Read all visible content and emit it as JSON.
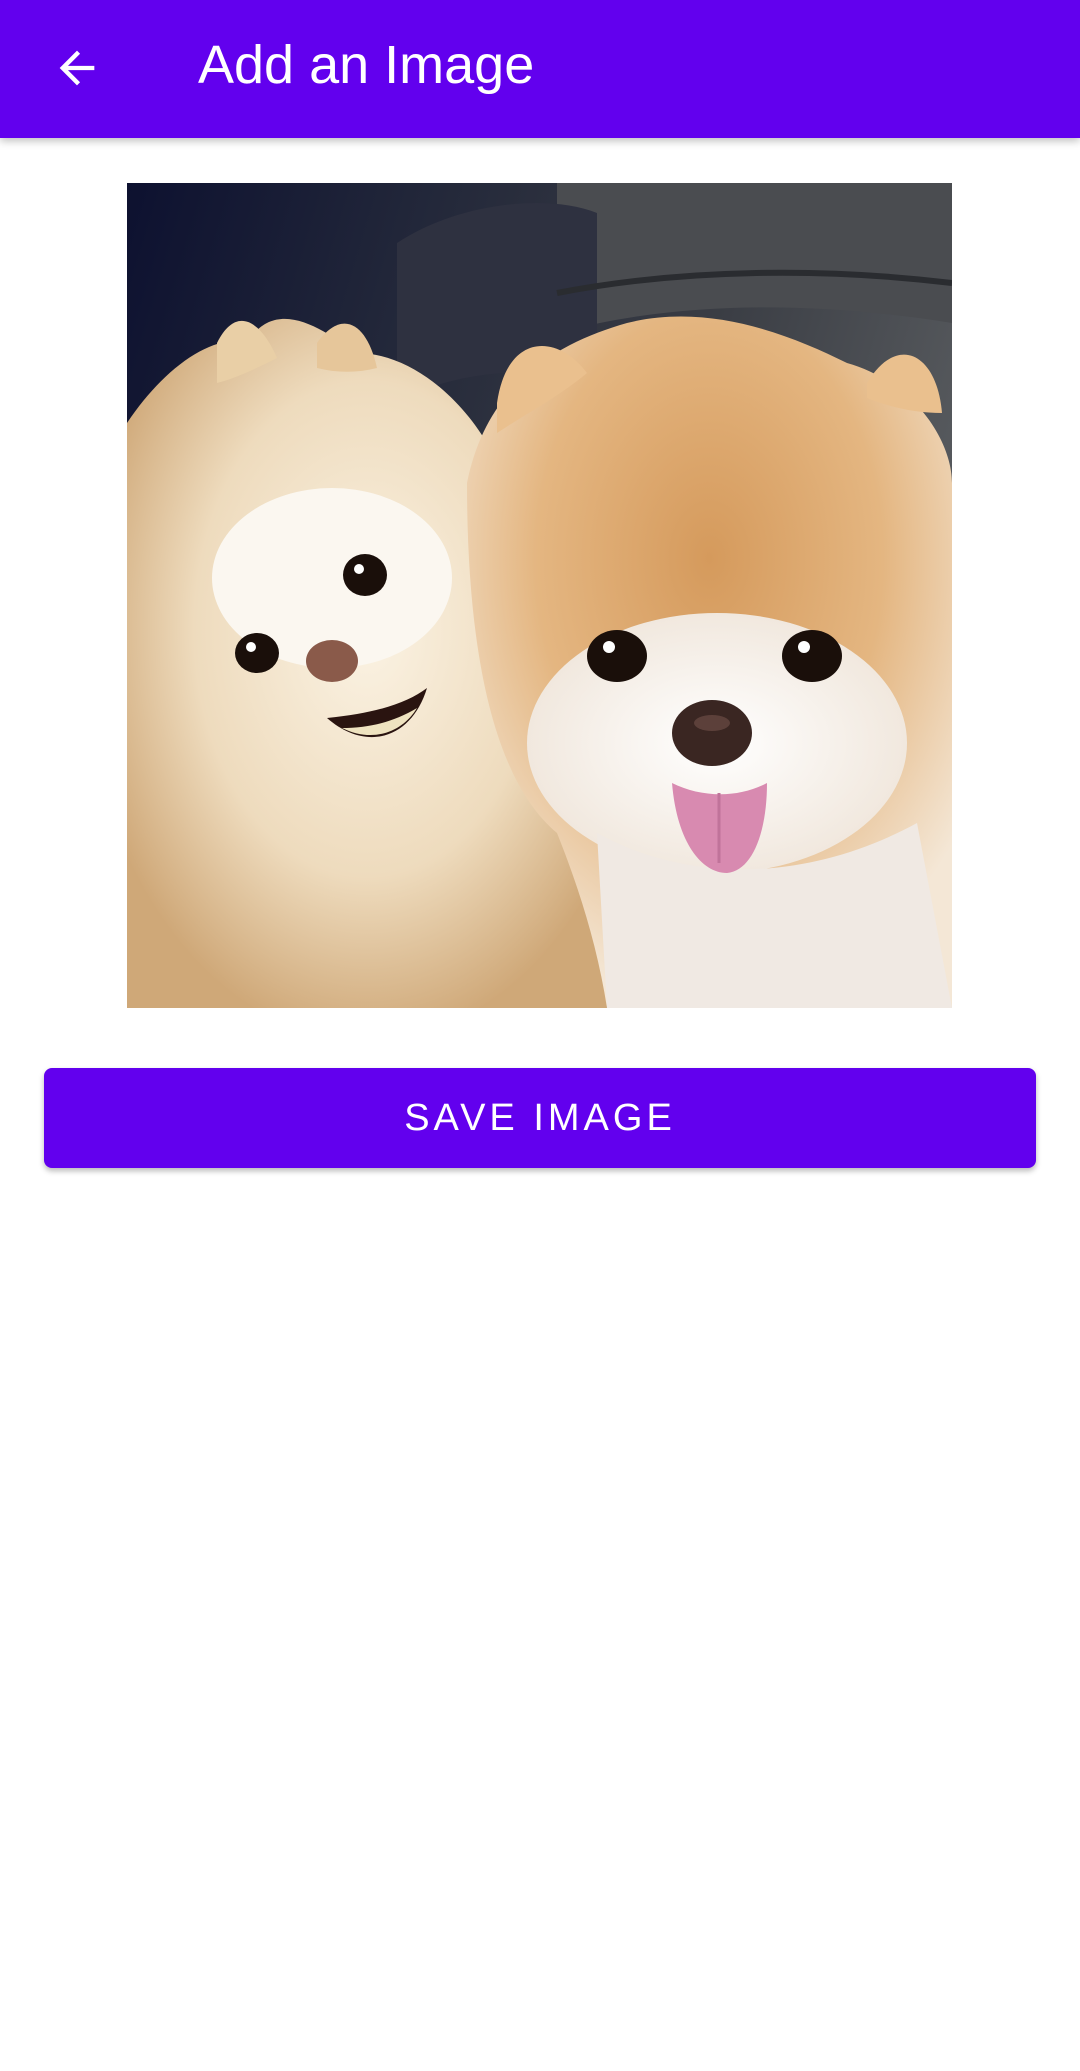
{
  "app_bar": {
    "title": "Add an Image",
    "back_icon": "arrow-back-icon",
    "background": "#6200EE"
  },
  "image": {
    "description_icon": "selected-photo",
    "subject": "two pomeranian dogs"
  },
  "actions": {
    "save_label": "SAVE IMAGE"
  },
  "colors": {
    "primary": "#6200EE",
    "on_primary": "#FFFFFF",
    "background": "#FFFFFF"
  }
}
